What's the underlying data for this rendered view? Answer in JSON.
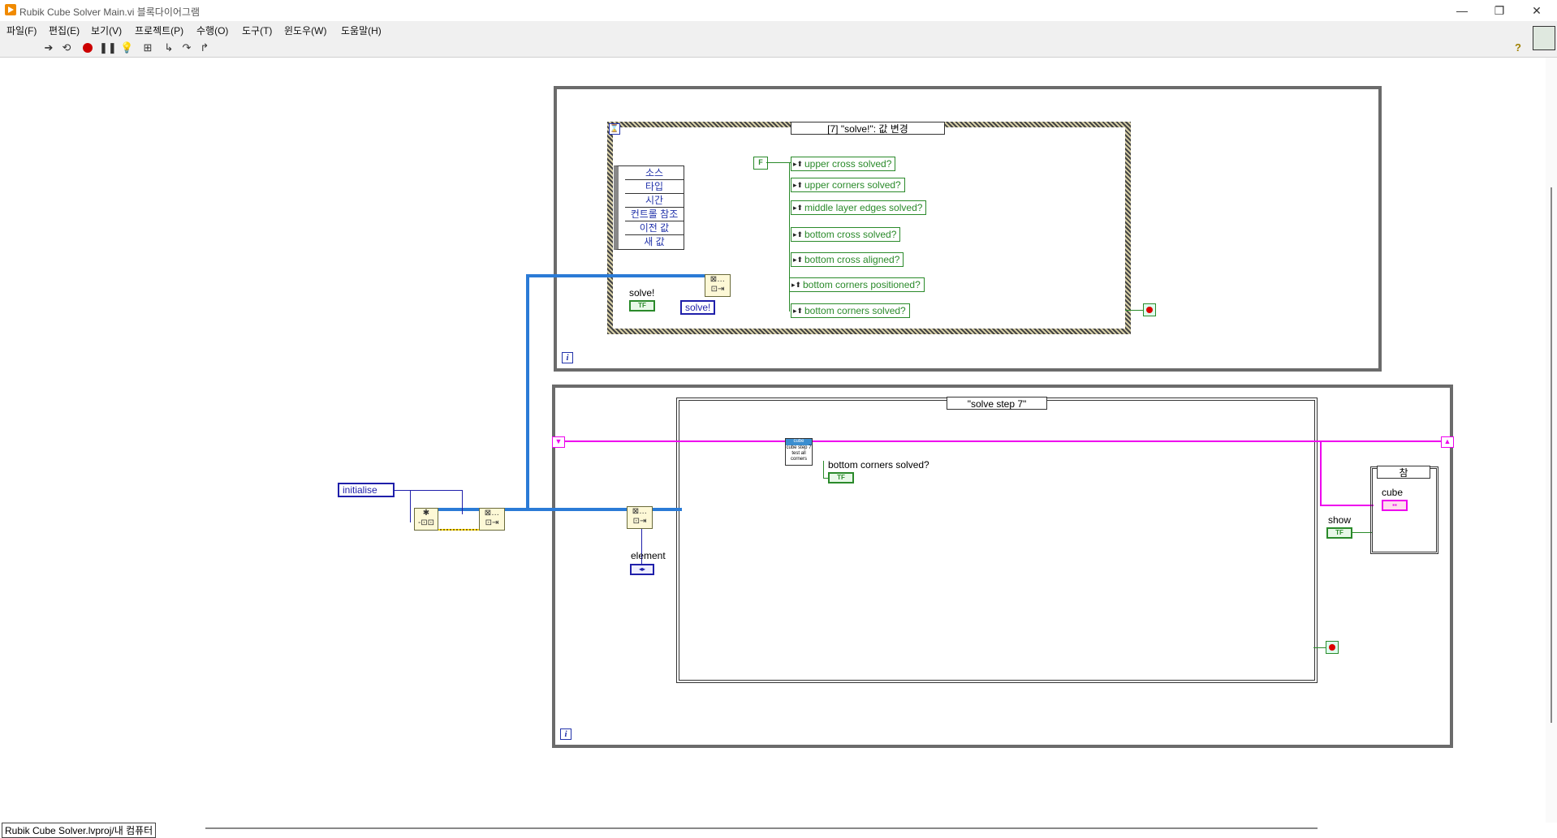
{
  "window": {
    "title": "Rubik Cube Solver Main.vi 블록다이어그램",
    "controls": [
      "—",
      "❐",
      "✕"
    ]
  },
  "menu": [
    "파일(F)",
    "편집(E)",
    "보기(V)",
    "프로젝트(P)",
    "수행(O)",
    "도구(T)",
    "윈도우(W)",
    "도움말(H)"
  ],
  "toolbar": {
    "icons": [
      "run-arrow-icon",
      "run-continuously-icon",
      "abort-icon",
      "pause-icon",
      "highlight-bulb-icon",
      "retain-wire-icon",
      "step-into-icon",
      "step-over-icon",
      "step-out-icon"
    ],
    "help_glyph": "?"
  },
  "event_loop": {
    "selector_label": "[7] \"solve!\": 값 변경",
    "event_data": [
      "소스",
      "타입",
      "시간",
      "컨트롤 참조",
      "이전 값",
      "새 값"
    ],
    "false_const": "F",
    "properties": [
      "upper cross solved?",
      "upper corners solved?",
      "middle layer edges solved?",
      "bottom cross solved?",
      "bottom cross aligned?",
      "bottom corners positioned?",
      "bottom corners solved?"
    ],
    "solve_label": "solve!",
    "solve_enum": "solve!",
    "bool_text": "TF",
    "iter_glyph": "i"
  },
  "main_loop": {
    "case_selector": "\"solve step 7\"",
    "subvi_text": "cube step 7 test all corners",
    "bottom_label": "bottom corners solved?",
    "element_label": "element",
    "show_label": "show",
    "inner_case_selector": "참",
    "cube_label": "cube",
    "bool_text": "TF",
    "iter_glyph": "i"
  },
  "init_enum": "initialise",
  "status": "Rubik Cube Solver.lvproj/내 컴퓨터",
  "colors": {
    "boolean_wire": "#2a8a2a",
    "cluster_wire": "#ee00ee",
    "queue_wire": "#2b7bd6",
    "enum_wire": "#1f1faa"
  }
}
